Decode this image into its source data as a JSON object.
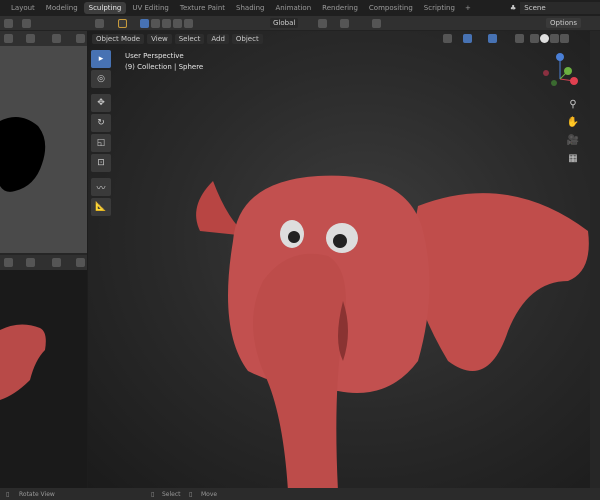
{
  "workspace_tabs": [
    "Layout",
    "Modeling",
    "Sculpting",
    "UV Editing",
    "Texture Paint",
    "Shading",
    "Animation",
    "Rendering",
    "Compositing",
    "Scripting"
  ],
  "active_tab": "Sculpting",
  "add_tab": "+",
  "scene": "Scene",
  "toolbar": {
    "orientation": "Global",
    "options": "Options"
  },
  "viewport": {
    "mode": "Object Mode",
    "menus": [
      "View",
      "Select",
      "Add",
      "Object"
    ],
    "perspective": "User Perspective",
    "collection": "(9) Collection | Sphere"
  },
  "status": {
    "rotate": "Rotate View",
    "select": "Select",
    "move": "Move"
  },
  "colors": {
    "accent": "#4772b3",
    "model": "#c2504f"
  }
}
